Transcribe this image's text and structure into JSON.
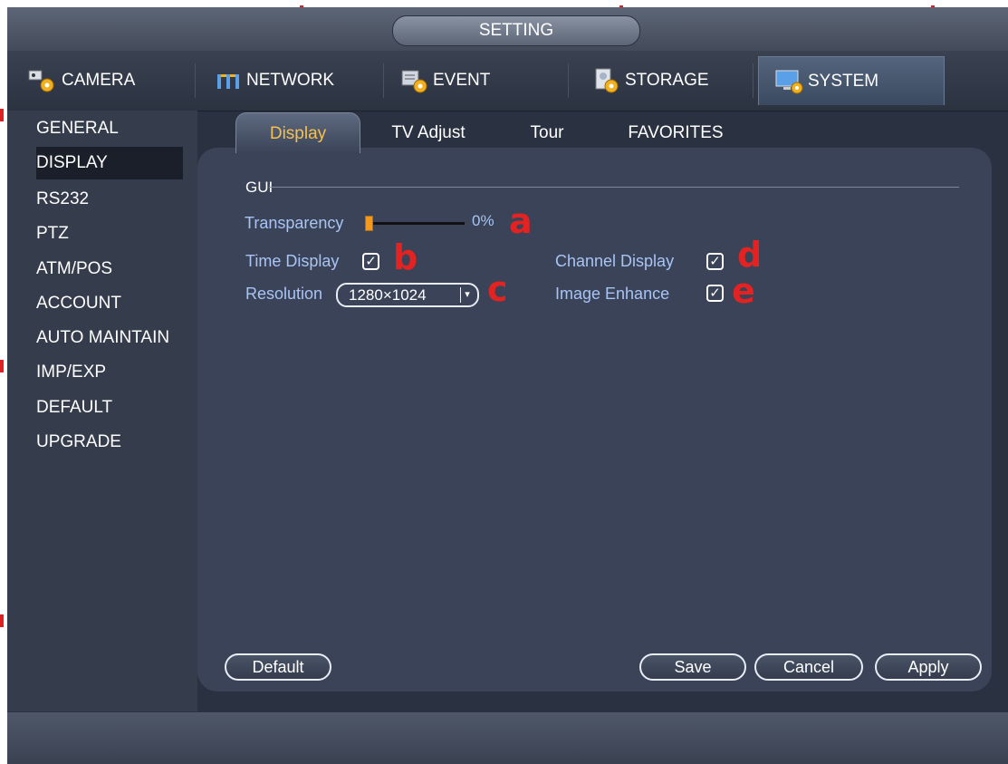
{
  "title": "SETTING",
  "top_nav": [
    {
      "label": "CAMERA",
      "icon": "camera-gear-icon"
    },
    {
      "label": "NETWORK",
      "icon": "network-icon"
    },
    {
      "label": "EVENT",
      "icon": "event-icon"
    },
    {
      "label": "STORAGE",
      "icon": "storage-icon"
    },
    {
      "label": "SYSTEM",
      "icon": "system-monitor-icon",
      "active": true
    }
  ],
  "sidebar": {
    "items": [
      {
        "label": "GENERAL"
      },
      {
        "label": "DISPLAY",
        "active": true
      },
      {
        "label": "RS232"
      },
      {
        "label": "PTZ"
      },
      {
        "label": "ATM/POS"
      },
      {
        "label": "ACCOUNT"
      },
      {
        "label": "AUTO MAINTAIN"
      },
      {
        "label": "IMP/EXP"
      },
      {
        "label": "DEFAULT"
      },
      {
        "label": "UPGRADE"
      }
    ]
  },
  "tabs": [
    {
      "label": "Display",
      "active": true
    },
    {
      "label": "TV Adjust"
    },
    {
      "label": "Tour"
    },
    {
      "label": "FAVORITES"
    }
  ],
  "display": {
    "section_label": "GUI",
    "transparency_label": "Transparency",
    "transparency_value": "0%",
    "transparency_fraction": 0,
    "time_display_label": "Time Display",
    "time_display_checked": true,
    "channel_display_label": "Channel Display",
    "channel_display_checked": true,
    "resolution_label": "Resolution",
    "resolution_value": "1280×1024",
    "image_enhance_label": "Image Enhance",
    "image_enhance_checked": true
  },
  "annotations": {
    "a": "a",
    "b": "b",
    "c": "c",
    "d": "d",
    "e": "e"
  },
  "buttons": {
    "default": "Default",
    "save": "Save",
    "cancel": "Cancel",
    "apply": "Apply"
  },
  "colors": {
    "accent": "#f6c04e",
    "label": "#a9c4f4",
    "annotation": "#e32222",
    "slider_thumb": "#f39a1e"
  }
}
